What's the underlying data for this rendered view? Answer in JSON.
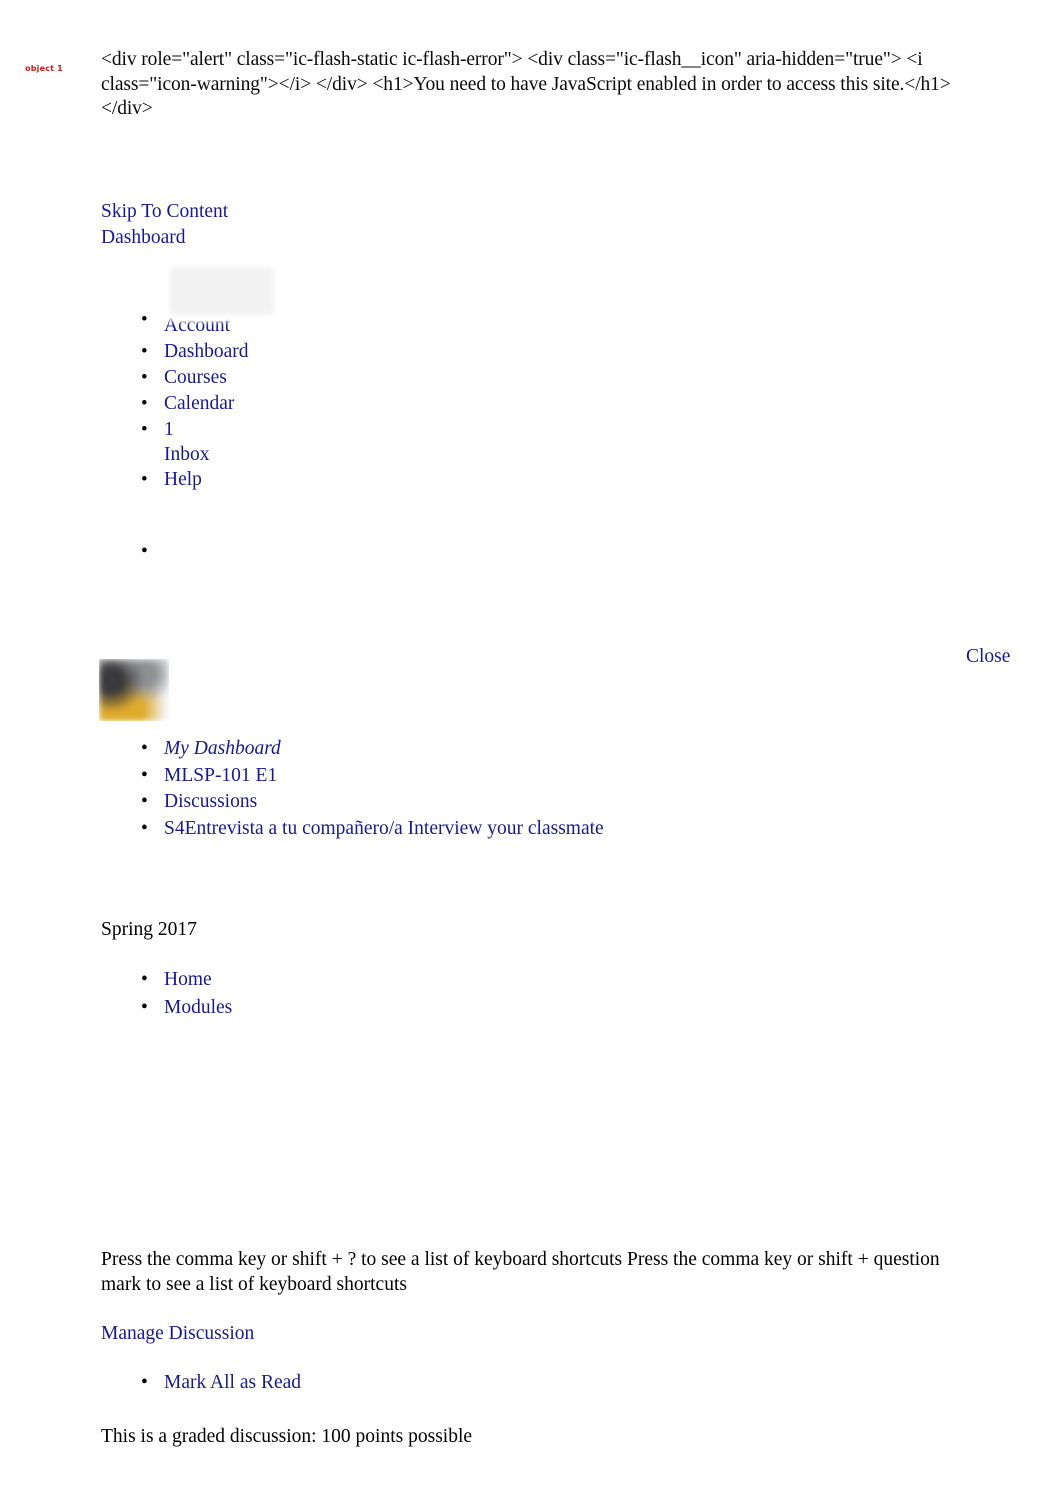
{
  "source_block": {
    "text": "<div role=\"alert\" class=\"ic-flash-static ic-flash-error\"> <div class=\"ic-flash__icon\" aria-hidden=\"true\"> <i class=\"icon-warning\"></i> </div> <h1>You need to have JavaScript enabled in order to access this site.</h1> </div>"
  },
  "skip": {
    "skip_to_content": "Skip To Content",
    "dashboard": "Dashboard"
  },
  "global_nav": {
    "items": [
      {
        "label": "Account",
        "icon": "account-thumbnail-image",
        "has_thumb": true
      },
      {
        "label": "Dashboard",
        "icon": "dashboard-icon",
        "has_thumb": false
      },
      {
        "label": "Courses",
        "icon": "courses-icon",
        "has_thumb": false
      },
      {
        "label": "Calendar",
        "icon": "calendar-icon",
        "has_thumb": false
      },
      {
        "label": "Inbox",
        "count": "1",
        "icon": "inbox-icon",
        "has_thumb": false
      },
      {
        "label": "Help",
        "icon": "help-icon",
        "has_thumb": false
      }
    ]
  },
  "tray": {
    "close_label": "Close",
    "avatar_caption": "object 1",
    "avatar_icon": "user-avatar-image"
  },
  "breadcrumbs": {
    "items": [
      {
        "label": "My Dashboard",
        "italic": true
      },
      {
        "label": "MLSP-101 E1",
        "italic": false
      },
      {
        "label": "Discussions",
        "italic": false
      },
      {
        "label": "S4Entrevista a tu compañero/a Interview your classmate",
        "italic": false
      }
    ]
  },
  "term": {
    "heading": "Spring 2017"
  },
  "course_nav": {
    "items": [
      {
        "label": "Home"
      },
      {
        "label": "Modules"
      }
    ]
  },
  "shortcuts": {
    "text": "Press the comma key or shift + ? to see a list of keyboard shortcuts Press the comma key or shift + question mark to see a list of keyboard shortcuts"
  },
  "discussion": {
    "manage_label": "Manage Discussion",
    "manage_items": [
      {
        "label": "Mark All as Read"
      }
    ],
    "graded_note": "This is a graded discussion: 100 points possible"
  },
  "colors": {
    "link": "#1a1a8c",
    "text": "#000000",
    "caption": "#d81717",
    "background": "#ffffff"
  }
}
